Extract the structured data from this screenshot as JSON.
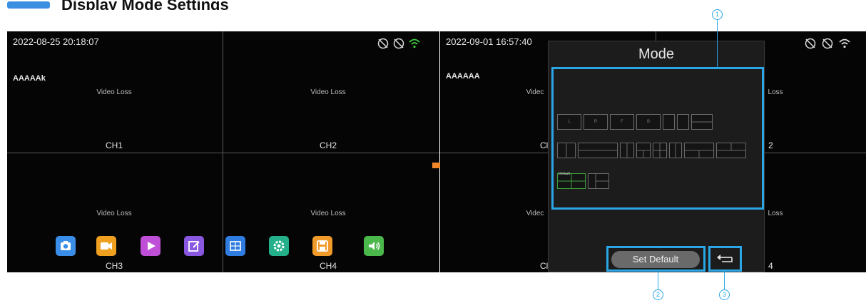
{
  "heading": {
    "text": "Display Mode Settings"
  },
  "left_screen": {
    "timestamp": "2022-08-25 20:18:07",
    "osd_text": "AAAAAk",
    "channels": [
      {
        "label": "CH1",
        "status": "Video Loss"
      },
      {
        "label": "CH2",
        "status": "Video Loss"
      },
      {
        "label": "CH3",
        "status": "Video Loss"
      },
      {
        "label": "CH4",
        "status": "Video Loss"
      }
    ],
    "status_icons": [
      "gps-off-icon",
      "gps-off-icon",
      "wifi-icon"
    ],
    "menu_bar": [
      {
        "name": "snapshot-icon",
        "color": "#3b8ee8"
      },
      {
        "name": "record-icon",
        "color": "#f0a020"
      },
      {
        "name": "playback-icon",
        "color": "#c04fd8"
      },
      {
        "name": "edit-icon",
        "color": "#8a58e0"
      },
      {
        "name": "layout-icon",
        "color": "#2f7de0"
      },
      {
        "name": "settings-icon",
        "color": "#24b08a"
      },
      {
        "name": "save-icon",
        "color": "#f09a2a"
      },
      {
        "name": "audio-icon",
        "color": "#4ab84a"
      }
    ]
  },
  "right_screen": {
    "timestamp": "2022-09-01 16:57:40",
    "osd_text": "AAAAAA",
    "partial_labels": {
      "vloss_left": "Videc",
      "vloss_right": "Loss",
      "ch_left_top": "Cl",
      "ch_right_top": "2",
      "ch_left_bottom": "Cl",
      "ch_right_bottom": "4"
    }
  },
  "dialog": {
    "title": "Mode",
    "row1": [
      "L",
      "R",
      "F",
      "B",
      "",
      "",
      ""
    ],
    "default_label": "Default",
    "set_default_label": "Set Default",
    "back_icon": "back-arrow-icon"
  },
  "callouts": {
    "one": "1",
    "two": "2",
    "three": "3"
  },
  "colors": {
    "highlight": "#2aa6e6",
    "selected": "#3ca23c",
    "arrow": "#f0862a"
  }
}
